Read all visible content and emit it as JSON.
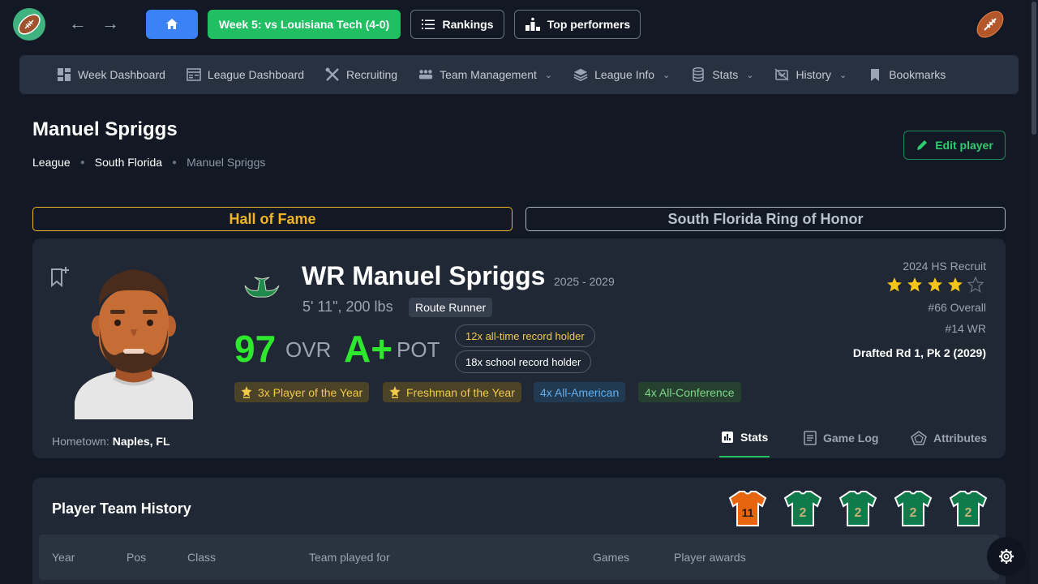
{
  "topbar": {
    "week_label": "Week 5: vs Louisiana Tech (4-0)",
    "rankings_label": "Rankings",
    "top_performers_label": "Top performers"
  },
  "menu": [
    {
      "label": "Week Dashboard",
      "icon": "dashboard-icon",
      "dropdown": false
    },
    {
      "label": "League Dashboard",
      "icon": "table-icon",
      "dropdown": false
    },
    {
      "label": "Recruiting",
      "icon": "tools-icon",
      "dropdown": false
    },
    {
      "label": "Team Management",
      "icon": "people-icon",
      "dropdown": true
    },
    {
      "label": "League Info",
      "icon": "layers-icon",
      "dropdown": true
    },
    {
      "label": "Stats",
      "icon": "database-icon",
      "dropdown": true
    },
    {
      "label": "History",
      "icon": "history-icon",
      "dropdown": true
    },
    {
      "label": "Bookmarks",
      "icon": "bookmark-icon",
      "dropdown": false
    }
  ],
  "page": {
    "title": "Manuel Spriggs",
    "breadcrumb": [
      "League",
      "South Florida",
      "Manuel Spriggs"
    ],
    "edit_label": "Edit player",
    "hall_of_fame": "Hall of Fame",
    "ring_of_honor": "South Florida Ring of Honor"
  },
  "player": {
    "name": "WR Manuel Spriggs",
    "years": "2025 - 2029",
    "size": "5' 11\", 200 lbs",
    "archetype": "Route Runner",
    "ovr": "97",
    "ovr_label": "OVR",
    "pot": "A+",
    "pot_label": "POT",
    "records": [
      "12x all-time record holder",
      "18x school record holder"
    ],
    "awards": [
      {
        "label": "3x Player of the Year",
        "style": "gold",
        "icon": "trophy-icon"
      },
      {
        "label": "Freshman of the Year",
        "style": "gold",
        "icon": "trophy-icon"
      },
      {
        "label": "4x All-American",
        "style": "blue",
        "icon": ""
      },
      {
        "label": "4x All-Conference",
        "style": "green",
        "icon": ""
      }
    ],
    "recruit_label": "2024 HS Recruit",
    "stars": 4,
    "stars_max": 5,
    "overall_rank": "#66 Overall",
    "position_rank": "#14 WR",
    "drafted": "Drafted Rd 1, Pk 2 (2029)",
    "hometown_label": "Hometown:",
    "hometown": "Naples, FL",
    "accent_green": "#2ee82e",
    "record_colors": [
      "#f3c94a",
      "#ffffff"
    ]
  },
  "tabs": [
    {
      "label": "Stats",
      "icon": "bar-chart-icon",
      "active": true
    },
    {
      "label": "Game Log",
      "icon": "document-icon",
      "active": false
    },
    {
      "label": "Attributes",
      "icon": "pentagon-icon",
      "active": false
    }
  ],
  "history": {
    "title": "Player Team History",
    "jerseys": [
      {
        "number": "11",
        "color": "#e8650f"
      },
      {
        "number": "2",
        "color": "#0f7a4a"
      },
      {
        "number": "2",
        "color": "#0f7a4a"
      },
      {
        "number": "2",
        "color": "#0f7a4a"
      },
      {
        "number": "2",
        "color": "#0f7a4a"
      }
    ],
    "columns": [
      "Year",
      "Pos",
      "Class",
      "Team played for",
      "Games",
      "Player awards"
    ]
  }
}
